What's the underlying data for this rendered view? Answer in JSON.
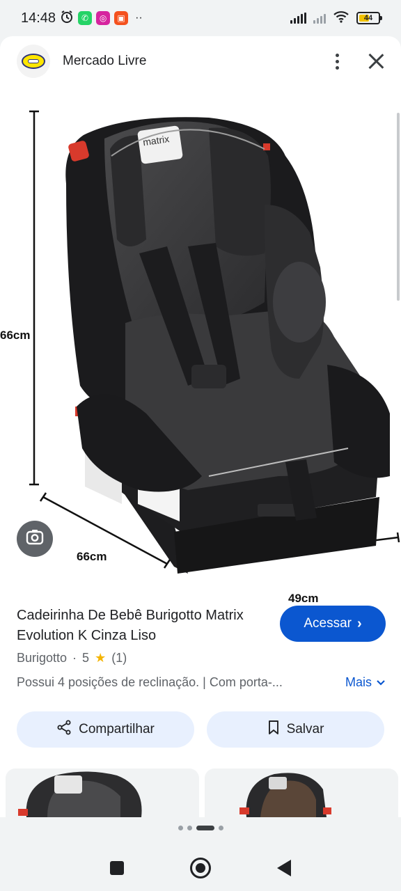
{
  "status_bar": {
    "time": "14:48",
    "battery_level": "44"
  },
  "source": {
    "name": "Mercado Livre"
  },
  "image": {
    "brand_label": "matrix",
    "dimension_height": "66cm",
    "dimension_depth": "66cm",
    "dimension_width": "49cm"
  },
  "product": {
    "title": "Cadeirinha De Bebê Burigotto Matrix Evolution K Cinza Liso",
    "visit_label": "Acessar",
    "seller": "Burigotto",
    "rating": "5",
    "rating_count": "(1)",
    "description": "Possui 4 posições de reclinação. | Com porta-...",
    "more_label": "Mais"
  },
  "actions": {
    "share_label": "Compartilhar",
    "save_label": "Salvar"
  },
  "colors": {
    "accent": "#0b57d0",
    "chip_bg": "#e8f0fe",
    "star": "#f4b400"
  }
}
